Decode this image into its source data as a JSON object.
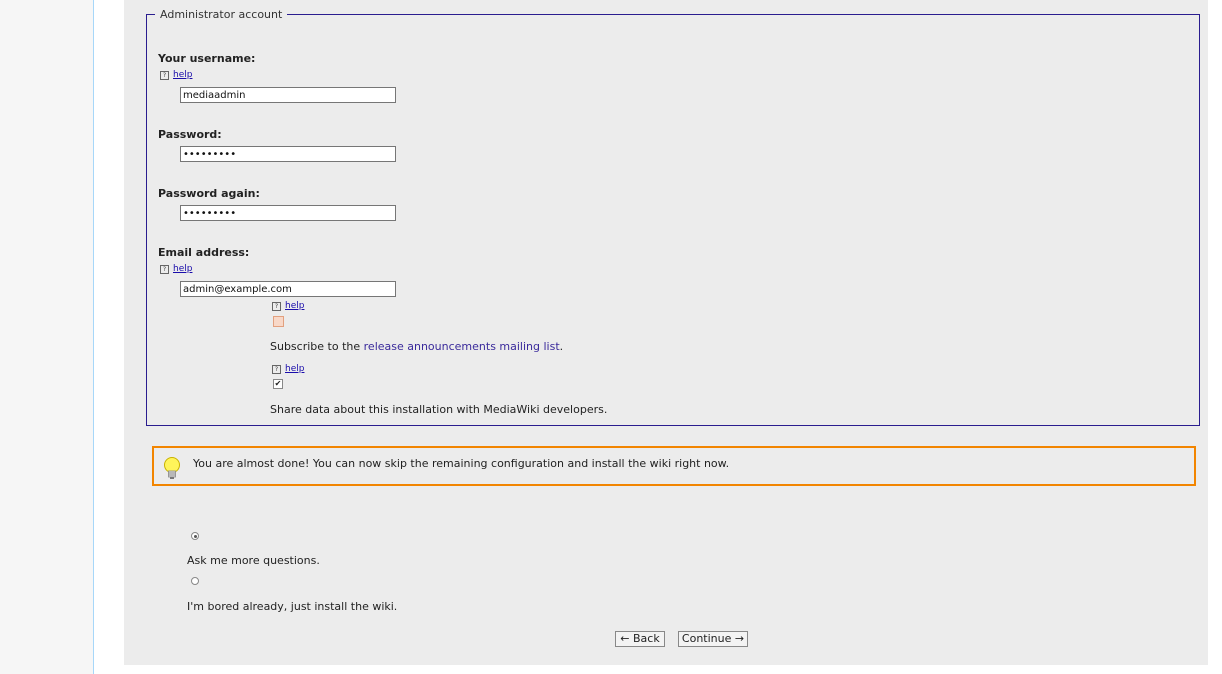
{
  "fieldset": {
    "legend": "Administrator account"
  },
  "username": {
    "label": "Your username:",
    "help": "help",
    "value": "mediaadmin"
  },
  "password": {
    "label": "Password:",
    "value": "•••••••••"
  },
  "password_again": {
    "label": "Password again:",
    "value": "•••••••••"
  },
  "email": {
    "label": "Email address:",
    "help": "help",
    "value": "admin@example.com"
  },
  "subscribe": {
    "help": "help",
    "checked": false,
    "text_before": "Subscribe to the ",
    "link": "release announcements mailing list",
    "text_after": "."
  },
  "share_data": {
    "help": "help",
    "checked": true,
    "check_glyph": "✔",
    "text": "Share data about this installation with MediaWiki developers."
  },
  "notice": {
    "icon": "lightbulb-icon",
    "message": "You are almost done! You can now skip the remaining configuration and install the wiki right now."
  },
  "options": [
    {
      "label": "Ask me more questions.",
      "checked": true
    },
    {
      "label": "I'm bored already, just install the wiki.",
      "checked": false
    }
  ],
  "buttons": {
    "back": "← Back",
    "continue": "Continue →"
  },
  "colors": {
    "fieldset_border": "#2a1d8f",
    "notice_border": "#f28500",
    "link": "#3a2a9b"
  }
}
